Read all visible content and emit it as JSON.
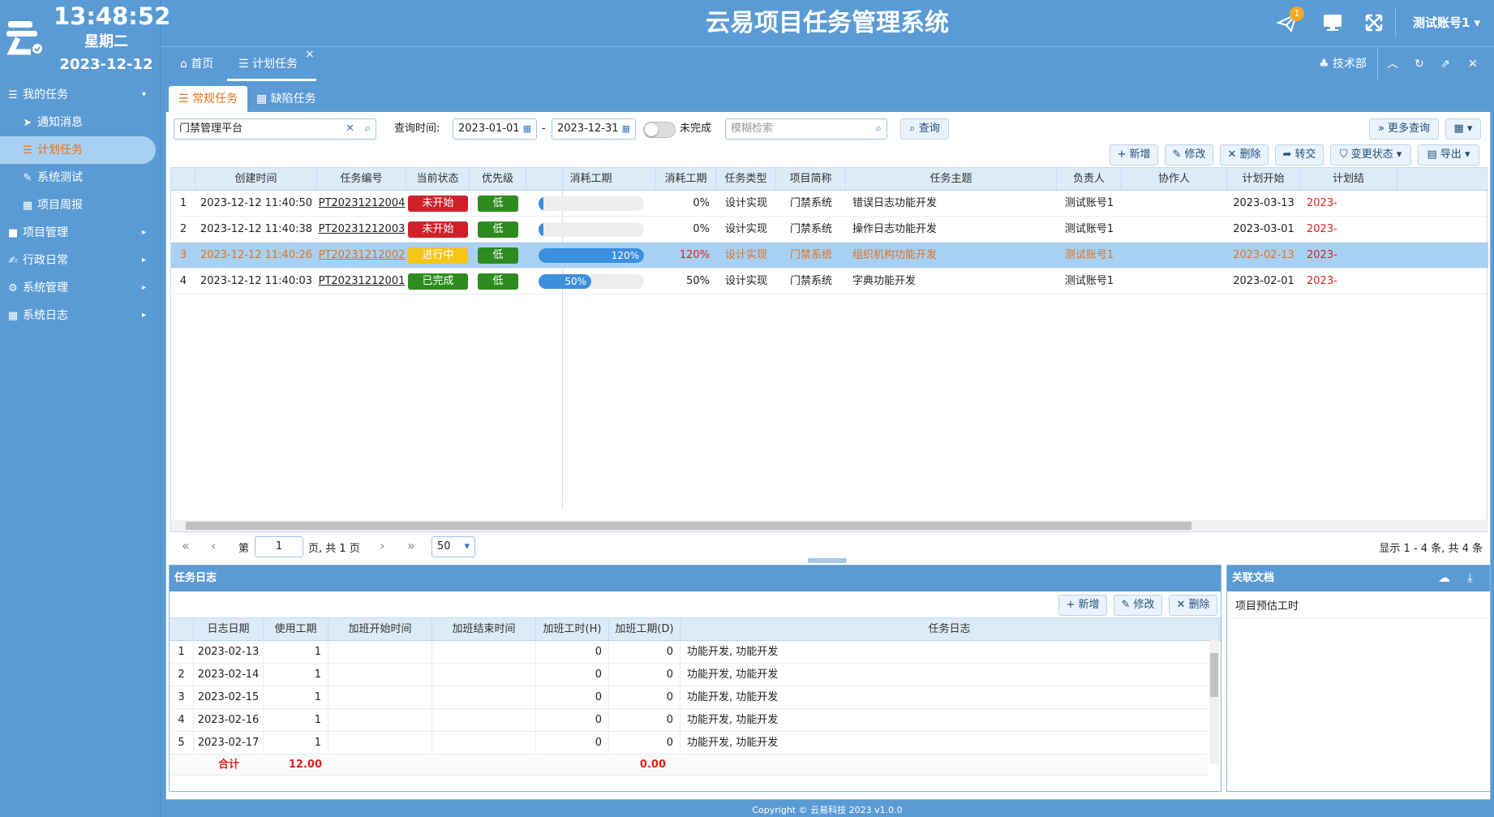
{
  "app": {
    "title": "云易项目任务管理系统",
    "time": "13:48:52",
    "weekday": "星期二",
    "date": "2023-12-12",
    "notification_count": "1",
    "user": "测试账号1",
    "department": "技术部",
    "footer": "Copyright © 云易科技 2023 v1.0.0",
    "accent_color": "#5b9bd5",
    "highlight_color": "#e3741c"
  },
  "sidebar": {
    "items": [
      {
        "label": "我的任务",
        "icon": "list-icon"
      },
      {
        "label": "通知消息",
        "icon": "send-icon"
      },
      {
        "label": "计划任务",
        "icon": "list-icon"
      },
      {
        "label": "系统测试",
        "icon": "pencil-icon"
      },
      {
        "label": "项目周报",
        "icon": "calendar-icon"
      },
      {
        "label": "项目管理",
        "icon": "folder-icon"
      },
      {
        "label": "行政日常",
        "icon": "edit-icon"
      },
      {
        "label": "系统管理",
        "icon": "gears-icon"
      },
      {
        "label": "系统日志",
        "icon": "calendar-icon"
      }
    ]
  },
  "tabs": {
    "home": "首页",
    "plan": "计划任务"
  },
  "subtabs": {
    "regular": "常规任务",
    "defect": "缺陷任务"
  },
  "filter": {
    "project": "门禁管理平台",
    "query_time_label": "查询时间:",
    "start_date": "2023-01-01",
    "dash": "-",
    "end_date": "2023-12-31",
    "incomplete_label": "未完成",
    "fuzzy_placeholder": "模糊检索",
    "query": "查询",
    "more_query": "更多查询"
  },
  "toolbar": {
    "add": "新增",
    "edit": "修改",
    "delete": "删除",
    "transfer": "转交",
    "change_status": "变更状态",
    "export": "导出"
  },
  "grid": {
    "columns": [
      "创建时间",
      "任务编号",
      "当前状态",
      "优先级",
      "消耗工期",
      "消耗工期",
      "任务类型",
      "项目简称",
      "任务主题",
      "负责人",
      "协作人",
      "计划开始",
      "计划结"
    ],
    "rows": [
      {
        "no": "1",
        "created": "2023-12-12 11:40:50",
        "code": "PT20231212004",
        "status": "未开始",
        "status_color": "#d0212b",
        "priority": "低",
        "progress": 0,
        "progress_label": "",
        "percent": "0%",
        "type": "设计实现",
        "project": "门禁系统",
        "subject": "错误日志功能开发",
        "owner": "测试账号1",
        "collab": "",
        "plan_start": "2023-03-13",
        "plan_end": "2023-"
      },
      {
        "no": "2",
        "created": "2023-12-12 11:40:38",
        "code": "PT20231212003",
        "status": "未开始",
        "status_color": "#d0212b",
        "priority": "低",
        "progress": 0,
        "progress_label": "",
        "percent": "0%",
        "type": "设计实现",
        "project": "门禁系统",
        "subject": "操作日志功能开发",
        "owner": "测试账号1",
        "collab": "",
        "plan_start": "2023-03-01",
        "plan_end": "2023-"
      },
      {
        "no": "3",
        "created": "2023-12-12 11:40:26",
        "code": "PT20231212002",
        "status": "进行中",
        "status_color": "#f5c518",
        "priority": "低",
        "progress": 1.0,
        "progress_label": "120%",
        "percent": "120%",
        "type": "设计实现",
        "project": "门禁系统",
        "subject": "组织机构功能开发",
        "owner": "测试账号1",
        "collab": "",
        "plan_start": "2023-02-13",
        "plan_end": "2023-"
      },
      {
        "no": "4",
        "created": "2023-12-12 11:40:03",
        "code": "PT20231212001",
        "status": "已完成",
        "status_color": "#2e8b1f",
        "priority": "低",
        "progress": 0.5,
        "progress_label": "50%",
        "percent": "50%",
        "type": "设计实现",
        "project": "门禁系统",
        "subject": "字典功能开发",
        "owner": "测试账号1",
        "collab": "",
        "plan_start": "2023-02-01",
        "plan_end": "2023-"
      }
    ],
    "priority_color": "#2e8b1f"
  },
  "pager": {
    "page_prefix": "第",
    "page": "1",
    "page_suffix": "页, 共 1 页",
    "page_size": "50",
    "summary": "显示 1 - 4 条, 共 4 条"
  },
  "log": {
    "title": "任务日志",
    "add": "新增",
    "edit": "修改",
    "delete": "删除",
    "columns": [
      "日志日期",
      "使用工期",
      "加班开始时间",
      "加班结束时间",
      "加班工时(H)",
      "加班工期(D)",
      "任务日志"
    ],
    "rows": [
      {
        "no": "1",
        "date": "2023-02-13",
        "used": "1",
        "ot_start": "",
        "ot_end": "",
        "ot_h": "0",
        "ot_d": "0",
        "log": "功能开发, 功能开发"
      },
      {
        "no": "2",
        "date": "2023-02-14",
        "used": "1",
        "ot_start": "",
        "ot_end": "",
        "ot_h": "0",
        "ot_d": "0",
        "log": "功能开发, 功能开发"
      },
      {
        "no": "3",
        "date": "2023-02-15",
        "used": "1",
        "ot_start": "",
        "ot_end": "",
        "ot_h": "0",
        "ot_d": "0",
        "log": "功能开发, 功能开发"
      },
      {
        "no": "4",
        "date": "2023-02-16",
        "used": "1",
        "ot_start": "",
        "ot_end": "",
        "ot_h": "0",
        "ot_d": "0",
        "log": "功能开发, 功能开发"
      },
      {
        "no": "5",
        "date": "2023-02-17",
        "used": "1",
        "ot_start": "",
        "ot_end": "",
        "ot_h": "0",
        "ot_d": "0",
        "log": "功能开发, 功能开发"
      }
    ],
    "total_label": "合计",
    "total_used": "12.00",
    "total_ot_d": "0.00"
  },
  "docs": {
    "title": "关联文档",
    "items": [
      "项目预估工时"
    ]
  }
}
